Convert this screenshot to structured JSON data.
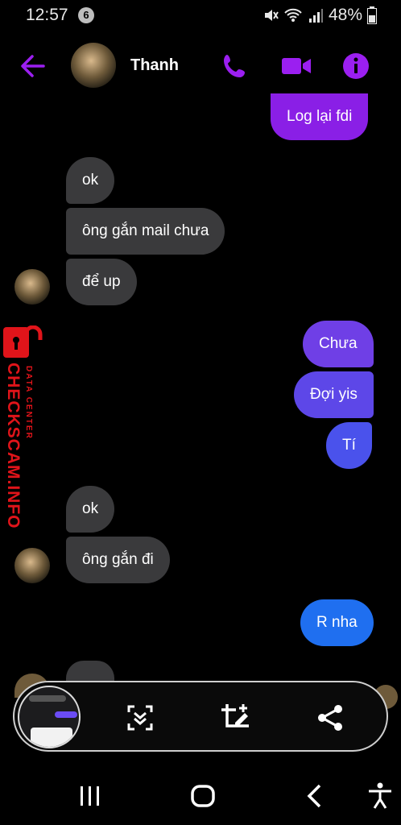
{
  "status_bar": {
    "time": "12:57",
    "notification_count": "6",
    "battery": "48%"
  },
  "header": {
    "contact_name": "Thanh"
  },
  "messages": [
    {
      "text": "Log lại fdi",
      "direction": "out",
      "color": "#8a1fe6"
    },
    {
      "text": "ok",
      "direction": "in"
    },
    {
      "text": "ông gắn mail chưa",
      "direction": "in"
    },
    {
      "text": "để up",
      "direction": "in"
    },
    {
      "text": "Chưa",
      "direction": "out",
      "color": "#6f3fe6"
    },
    {
      "text": "Đợi yis",
      "direction": "out",
      "color": "#5d47e8"
    },
    {
      "text": "Tí",
      "direction": "out",
      "color": "#4a52ec"
    },
    {
      "text": "ok",
      "direction": "in"
    },
    {
      "text": "ông gắn đi",
      "direction": "in"
    },
    {
      "text": "R nha",
      "direction": "out",
      "color": "#1f6ff0"
    }
  ],
  "watermark": {
    "brand": "CHECKSCAM.INFO",
    "subtitle": "DATA CENTER"
  },
  "colors": {
    "accent": "#9b1ff0",
    "incoming_bubble": "#3a3a3c",
    "watermark_red": "#e0141a"
  },
  "icons": {
    "header": [
      "back-arrow-icon",
      "phone-icon",
      "video-camera-icon",
      "info-icon"
    ],
    "toolbar": [
      "scroll-capture-icon",
      "crop-edit-icon",
      "share-icon"
    ],
    "navbar": [
      "recent-apps-icon",
      "home-icon",
      "back-icon",
      "accessibility-icon"
    ]
  }
}
